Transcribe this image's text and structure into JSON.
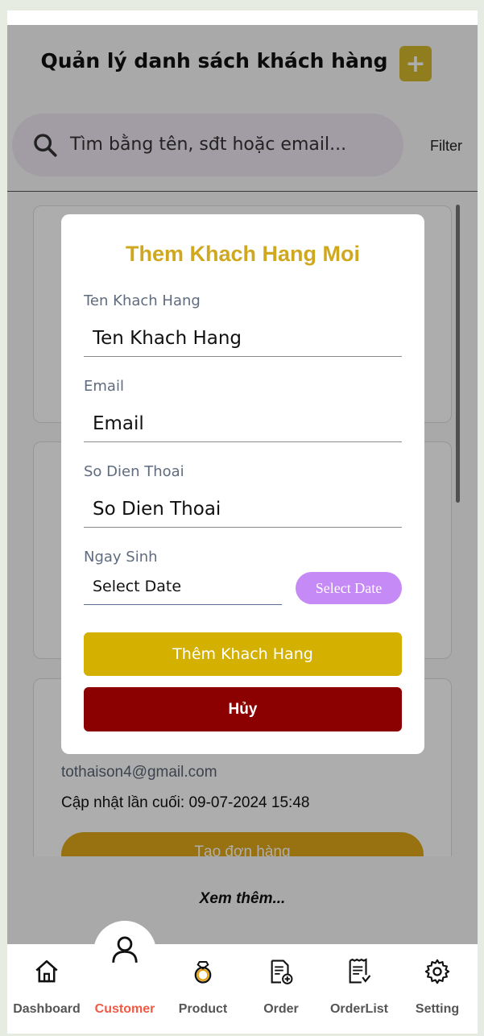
{
  "header": {
    "title": "Quản lý danh sách khách hàng",
    "add_icon": "plus-icon"
  },
  "search": {
    "placeholder": "Tìm bằng tên, sđt hoặc email...",
    "icon": "search-icon",
    "filter_label": "Filter"
  },
  "customer_card": {
    "email": "tothaison4@gmail.com",
    "last_updated": "Cập nhật lần cuối: 09-07-2024 15:48",
    "order_button": "Tạo đơn hàng"
  },
  "see_more": "Xem thêm...",
  "modal": {
    "title": "Them Khach Hang Moi",
    "name_label": "Ten Khach Hang",
    "name_placeholder": "Ten Khach Hang",
    "email_label": "Email",
    "email_placeholder": "Email",
    "phone_label": "So Dien Thoai",
    "phone_placeholder": "So Dien Thoai",
    "birthday_label": "Ngay Sinh",
    "date_value": "Select Date",
    "date_button": "Select Date",
    "submit_button": "Thêm Khach Hang",
    "cancel_button": "Hủy"
  },
  "tabs": [
    {
      "label": "Dashboard",
      "icon": "home-icon"
    },
    {
      "label": "Customer",
      "icon": "user-icon",
      "active": true
    },
    {
      "label": "Product",
      "icon": "ring-icon"
    },
    {
      "label": "Order",
      "icon": "document-add-icon"
    },
    {
      "label": "OrderList",
      "icon": "receipt-icon"
    },
    {
      "label": "Setting",
      "icon": "gear-icon"
    }
  ],
  "colors": {
    "accent_gold": "#d4b000",
    "cancel_red": "#8b0000",
    "date_button_purple": "#c58af5",
    "active_tab": "#ef5a45"
  }
}
